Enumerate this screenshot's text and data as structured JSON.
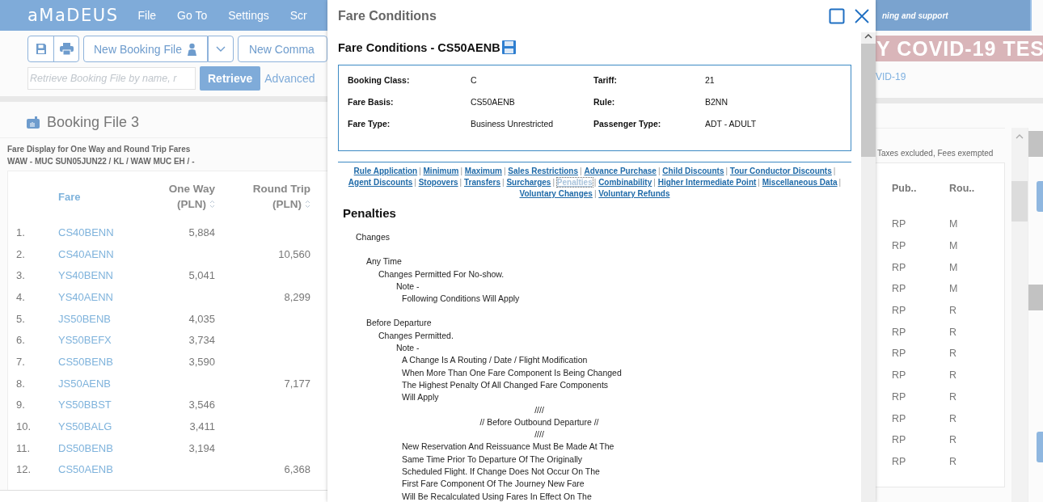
{
  "app": {
    "logo": "aMaDEUS",
    "menu": [
      "File",
      "Go To",
      "Settings",
      "Scr"
    ],
    "toolbar": {
      "new_booking": "New Booking File",
      "new_command": "New Comma"
    },
    "retrieve": {
      "placeholder": "Retrieve Booking File by name, r",
      "button": "Retrieve",
      "advanced": "Advanced"
    },
    "support_bar": "ning and support",
    "banner": "Y COVID-19 TES",
    "banner_link": "VID-19",
    "booking_file": "Booking File 3",
    "fare_display": {
      "title": "Fare Display for One Way and Round Trip Fares",
      "route": "WAW - MUC SUN05JUN22 / KL / WAW MUC EH / -",
      "note": "Taxes excluded, Fees exempted"
    },
    "table": {
      "columns": [
        {
          "label": "Fare",
          "sortable": false
        },
        {
          "label": "One Way",
          "unit": "(PLN)",
          "sortable": true
        },
        {
          "label": "Round Trip",
          "unit": "(PLN)",
          "sortable": true
        },
        {
          "label": "Pub..",
          "sortable": false
        },
        {
          "label": "Rou..",
          "sortable": false
        }
      ],
      "rows": [
        {
          "number": "1.",
          "fare": "CS40BENN",
          "one_way": "5,884",
          "pub": "RP",
          "rou": "M"
        },
        {
          "number": "2.",
          "fare": "CS40AENN",
          "round_trip": "10,560",
          "pub": "RP",
          "rou": "M"
        },
        {
          "number": "3.",
          "fare": "YS40BENN",
          "one_way": "5,041",
          "pub": "RP",
          "rou": "M"
        },
        {
          "number": "4.",
          "fare": "YS40AENN",
          "round_trip": "8,299",
          "pub": "RP",
          "rou": "M"
        },
        {
          "number": "5.",
          "fare": "JS50BENB",
          "one_way": "4,035",
          "pub": "RP",
          "rou": "R"
        },
        {
          "number": "6.",
          "fare": "YS50BEFX",
          "one_way": "3,734",
          "pub": "RP",
          "rou": "R"
        },
        {
          "number": "7.",
          "fare": "CS50BENB",
          "one_way": "3,590",
          "pub": "RP",
          "rou": "R"
        },
        {
          "number": "8.",
          "fare": "JS50AENB",
          "round_trip": "7,177",
          "pub": "RP",
          "rou": "R"
        },
        {
          "number": "9.",
          "fare": "YS50BBST",
          "one_way": "3,546",
          "pub": "RP",
          "rou": "R"
        },
        {
          "number": "10.",
          "fare": "YS50BALG",
          "one_way": "3,411",
          "pub": "RP",
          "rou": "R"
        },
        {
          "number": "11.",
          "fare": "DS50BENB",
          "one_way": "3,194",
          "pub": "RP",
          "rou": "R"
        },
        {
          "number": "12.",
          "fare": "CS50AENB",
          "round_trip": "6,368",
          "pub": "RP",
          "rou": "R"
        }
      ]
    }
  },
  "dialog": {
    "title": "Fare Conditions",
    "heading": "Fare Conditions - CS50AENB",
    "info": [
      {
        "label": "Booking Class:",
        "value": "C"
      },
      {
        "label": "Tariff:",
        "value": "21"
      },
      {
        "label": "Fare Basis:",
        "value": "CS50AENB"
      },
      {
        "label": "Rule:",
        "value": "B2NN"
      },
      {
        "label": "Fare Type:",
        "value": "Business Unrestricted"
      },
      {
        "label": "Passenger Type:",
        "value": "ADT - ADULT"
      }
    ],
    "link_separator": "|",
    "links": [
      {
        "label": "Rule Application",
        "selected": false
      },
      {
        "label": "Minimum",
        "selected": false
      },
      {
        "label": "Maximum",
        "selected": false
      },
      {
        "label": "Sales Restrictions",
        "selected": false
      },
      {
        "label": "Advance Purchase",
        "selected": false
      },
      {
        "label": "Child Discounts",
        "selected": false
      },
      {
        "label": "Tour Conductor Discounts",
        "selected": false
      },
      {
        "label": "Agent Discounts",
        "selected": false
      },
      {
        "label": "Stopovers",
        "selected": false
      },
      {
        "label": "Transfers",
        "selected": false
      },
      {
        "label": "Surcharges",
        "selected": false
      },
      {
        "label": "Penalties",
        "selected": true
      },
      {
        "label": "Combinability",
        "selected": false
      },
      {
        "label": "Higher Intermediate Point",
        "selected": false
      },
      {
        "label": "Miscellaneous Data",
        "selected": false
      },
      {
        "label": "Voluntary Changes",
        "selected": false
      },
      {
        "label": "Voluntary Refunds",
        "selected": false
      }
    ],
    "section_title": "Penalties",
    "penalties": [
      {
        "text": "Changes",
        "children": [
          {
            "text": "Any Time",
            "children": [
              {
                "text": "Changes Permitted For No-show.",
                "children": [
                  {
                    "text": "Note -",
                    "children": [
                      {
                        "text": "Following Conditions Will Apply"
                      }
                    ]
                  }
                ]
              }
            ]
          },
          {
            "text": "Before Departure",
            "children": [
              {
                "text": "Changes Permitted.",
                "children": [
                  {
                    "text": "Note -",
                    "children": [
                      {
                        "text": "A Change Is A Routing / Date / Flight Modification"
                      },
                      {
                        "text": "When More Than One Fare Component Is Being Changed"
                      },
                      {
                        "text": "The Highest Penalty Of All Changed Fare Components"
                      },
                      {
                        "text": "Will Apply"
                      },
                      {
                        "text": "////",
                        "kind": "center"
                      },
                      {
                        "text": "// Before Outbound Departure //",
                        "kind": "center"
                      },
                      {
                        "text": "////",
                        "kind": "center"
                      },
                      {
                        "text": "New Reservation And Reissuance Must Be Made At The"
                      },
                      {
                        "text": "Same Time Prior To Departure Of The Originally"
                      },
                      {
                        "text": "Scheduled Flight. If Change Does Not Occur On The"
                      },
                      {
                        "text": "First Fare Component Of The Journey New Fare"
                      },
                      {
                        "text": "Will Be Recalculated Using Fares In Effect On The"
                      }
                    ]
                  }
                ]
              }
            ]
          }
        ]
      }
    ]
  }
}
